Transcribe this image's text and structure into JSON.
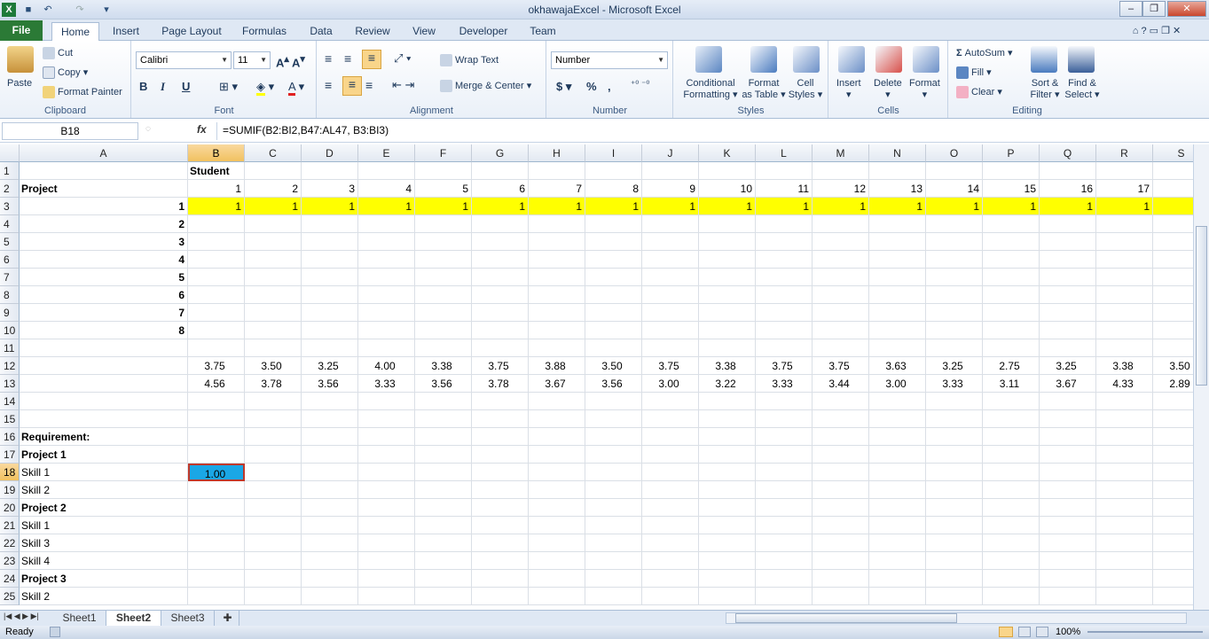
{
  "window": {
    "title": "okhawajaExcel - Microsoft Excel"
  },
  "ribbon_tabs": [
    "File",
    "Home",
    "Insert",
    "Page Layout",
    "Formulas",
    "Data",
    "Review",
    "View",
    "Developer",
    "Team"
  ],
  "clipboard": {
    "paste": "Paste",
    "cut": "Cut",
    "copy": "Copy",
    "format_painter": "Format Painter",
    "group": "Clipboard"
  },
  "font": {
    "name": "Calibri",
    "size": "11",
    "group": "Font",
    "bold": "B",
    "italic": "I",
    "underline": "U"
  },
  "alignment": {
    "wrap": "Wrap Text",
    "merge": "Merge & Center",
    "group": "Alignment"
  },
  "number": {
    "format": "Number",
    "currency": "$",
    "percent": "%",
    "comma": ",",
    "group": "Number"
  },
  "styles": {
    "conditional": "Conditional",
    "conditional2": "Formatting",
    "format_table": "Format",
    "format_table2": "as Table",
    "cell_styles": "Cell",
    "cell_styles2": "Styles",
    "group": "Styles"
  },
  "cells": {
    "insert": "Insert",
    "delete": "Delete",
    "format": "Format",
    "group": "Cells"
  },
  "editing": {
    "autosum": "AutoSum",
    "fill": "Fill",
    "clear": "Clear",
    "sort": "Sort &",
    "sort2": "Filter",
    "find": "Find &",
    "find2": "Select",
    "group": "Editing"
  },
  "formula_bar": {
    "name_box": "B18",
    "fx": "fx",
    "formula": "=SUMIF(B2:BI2,B47:AL47, B3:BI3)"
  },
  "columns": [
    "A",
    "B",
    "C",
    "D",
    "E",
    "F",
    "G",
    "H",
    "I",
    "J",
    "K",
    "L",
    "M",
    "N",
    "O",
    "P",
    "Q",
    "R",
    "S"
  ],
  "rows": {
    "r1": {
      "B": "Student"
    },
    "r2": {
      "A": "Project",
      "vals": [
        "1",
        "2",
        "3",
        "4",
        "5",
        "6",
        "7",
        "8",
        "9",
        "10",
        "11",
        "12",
        "13",
        "14",
        "15",
        "16",
        "17"
      ]
    },
    "r3": {
      "A": "1",
      "vals": [
        "1",
        "1",
        "1",
        "1",
        "1",
        "1",
        "1",
        "1",
        "1",
        "1",
        "1",
        "1",
        "1",
        "1",
        "1",
        "1",
        "1"
      ]
    },
    "r4": {
      "A": "2"
    },
    "r5": {
      "A": "3"
    },
    "r6": {
      "A": "4"
    },
    "r7": {
      "A": "5"
    },
    "r8": {
      "A": "6"
    },
    "r9": {
      "A": "7"
    },
    "r10": {
      "A": "8"
    },
    "r12": {
      "vals": [
        "3.75",
        "3.50",
        "3.25",
        "4.00",
        "3.38",
        "3.75",
        "3.88",
        "3.50",
        "3.75",
        "3.38",
        "3.75",
        "3.75",
        "3.63",
        "3.25",
        "2.75",
        "3.25",
        "3.38",
        "3.50"
      ]
    },
    "r13": {
      "vals": [
        "4.56",
        "3.78",
        "3.56",
        "3.33",
        "3.56",
        "3.78",
        "3.67",
        "3.56",
        "3.00",
        "3.22",
        "3.33",
        "3.44",
        "3.00",
        "3.33",
        "3.11",
        "3.67",
        "4.33",
        "2.89"
      ]
    },
    "r16": {
      "A": "Requirement:"
    },
    "r17": {
      "A": "Project 1"
    },
    "r18": {
      "A": "Skill 1",
      "B": "1.00"
    },
    "r19": {
      "A": "Skill 2"
    },
    "r20": {
      "A": "Project 2"
    },
    "r21": {
      "A": "Skill 1"
    },
    "r22": {
      "A": "Skill 3"
    },
    "r23": {
      "A": "Skill 4"
    },
    "r24": {
      "A": "Project 3"
    },
    "r25": {
      "A": "Skill 2"
    }
  },
  "sheets": [
    "Sheet1",
    "Sheet2",
    "Sheet3"
  ],
  "status": {
    "ready": "Ready",
    "zoom": "100%"
  },
  "colors": {
    "highlight_row": "#ffff00",
    "selected_cell": "#1aa7e6",
    "file_tab": "#2b7a36"
  }
}
